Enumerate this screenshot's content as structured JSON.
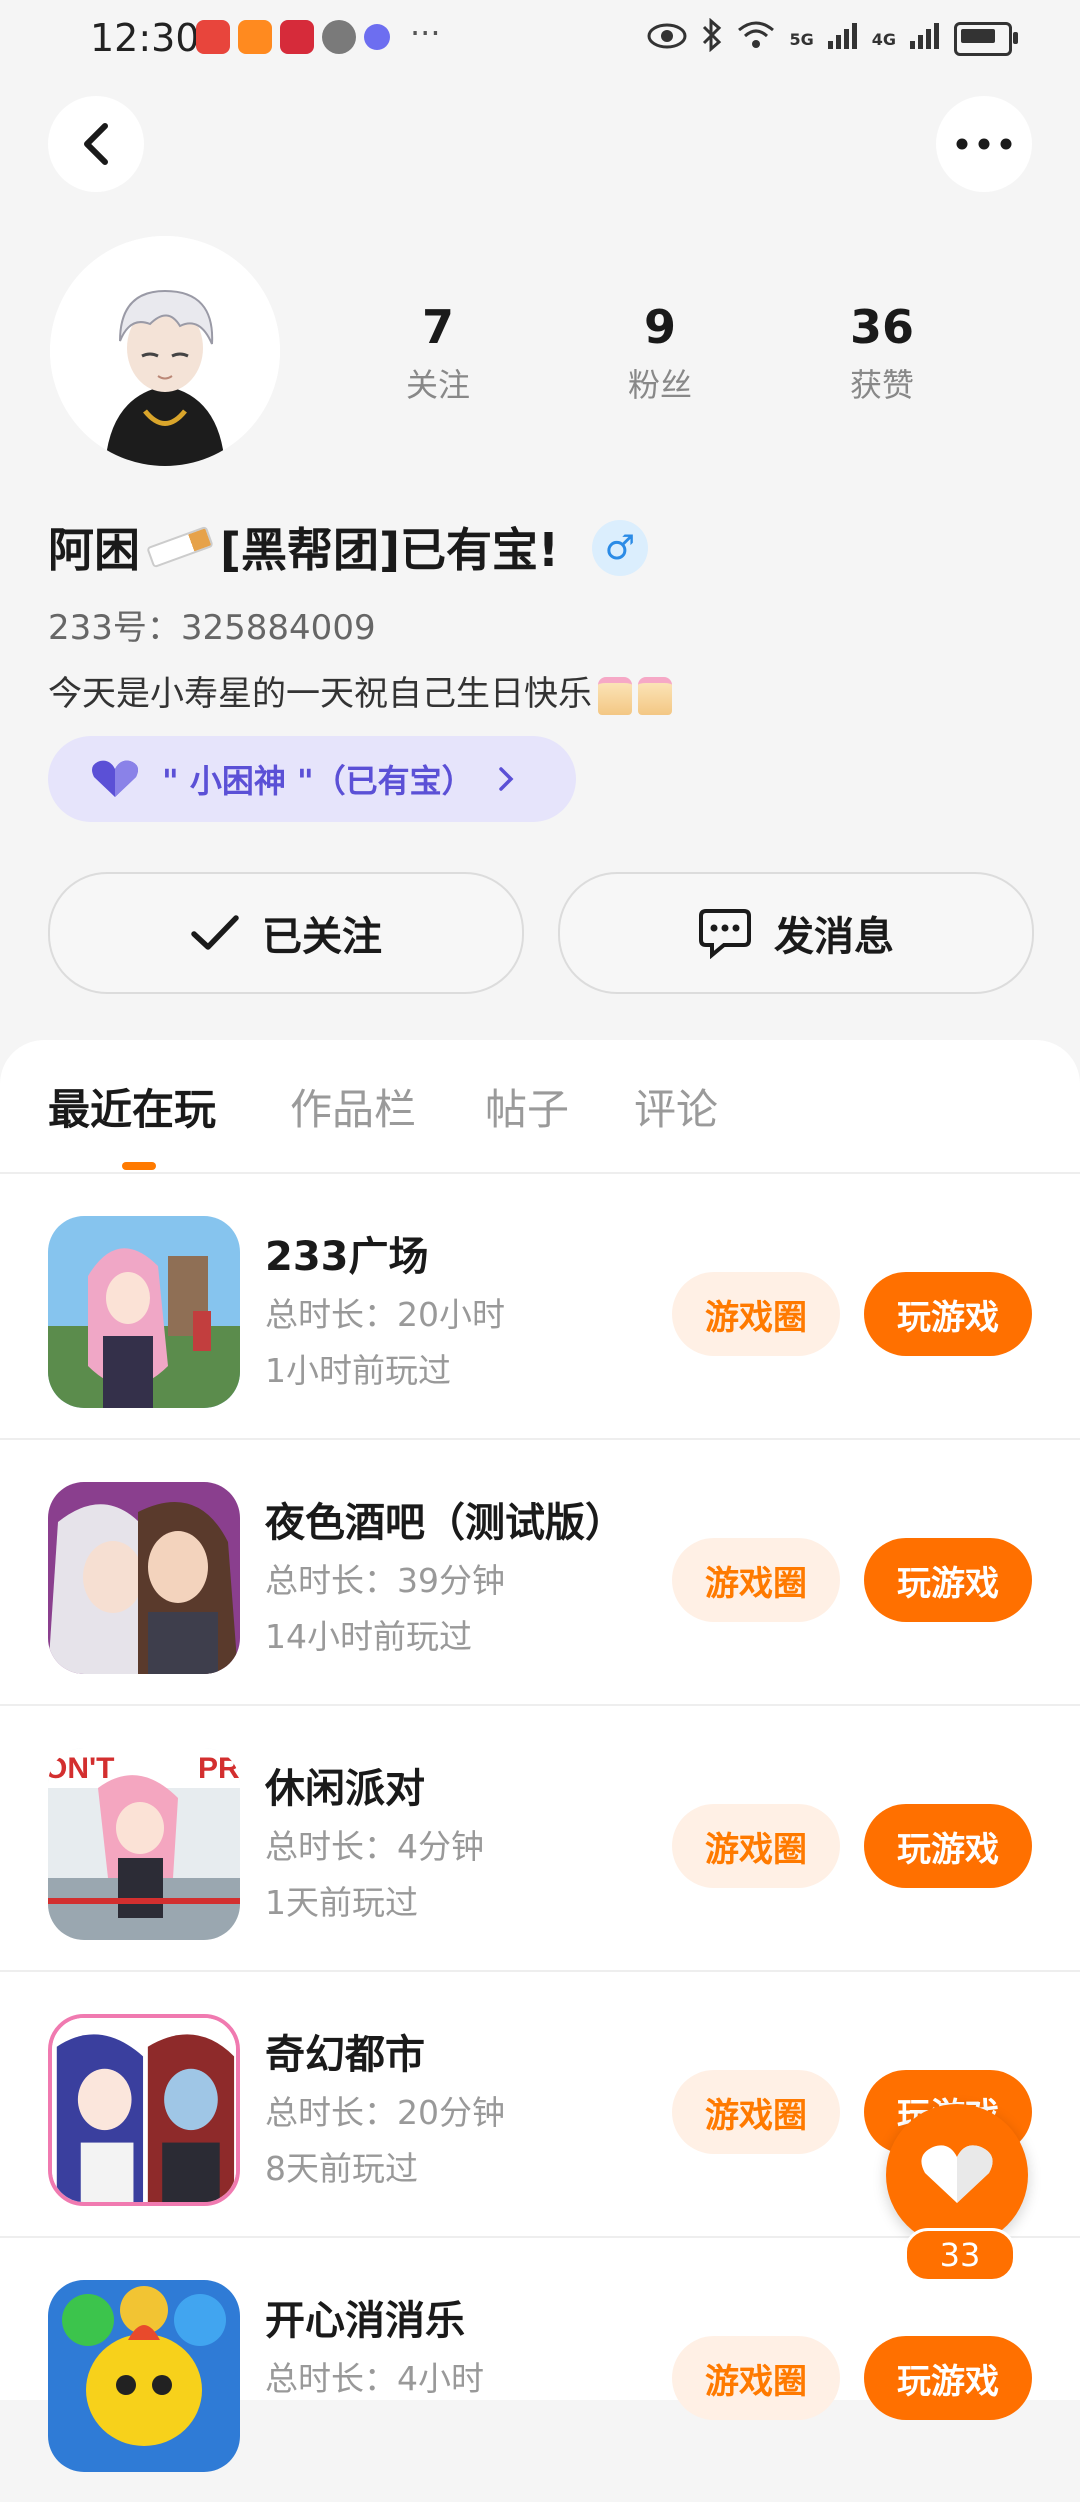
{
  "status_bar": {
    "time": "12:30",
    "more": "···",
    "signal_5g": "5G",
    "signal_4g": "4G"
  },
  "profile": {
    "stats": [
      {
        "value": "7",
        "label": "关注"
      },
      {
        "value": "9",
        "label": "粉丝"
      },
      {
        "value": "36",
        "label": "获赞"
      }
    ],
    "nickname_prefix": "阿困",
    "nickname_suffix": "[黑帮团]已有宝!",
    "gender_symbol": "♂",
    "uid": "233号：325884009",
    "bio": "今天是小寿星的一天祝自己生日快乐",
    "badge_text": "\" 小困神 \"（已有宝）",
    "follow_label": "已关注",
    "message_label": "发消息"
  },
  "tabs": [
    "最近在玩",
    "作品栏",
    "帖子",
    "评论"
  ],
  "games": [
    {
      "name": "233广场",
      "duration": "总时长：20小时",
      "last_played": "1小时前玩过",
      "circle_label": "游戏圈",
      "play_label": "玩游戏"
    },
    {
      "name": "夜色酒吧（测试版）",
      "duration": "总时长：39分钟",
      "last_played": "14小时前玩过",
      "circle_label": "游戏圈",
      "play_label": "玩游戏"
    },
    {
      "name": "休闲派对",
      "duration": "总时长：4分钟",
      "last_played": "1天前玩过",
      "circle_label": "游戏圈",
      "play_label": "玩游戏"
    },
    {
      "name": "奇幻都市",
      "duration": "总时长：20分钟",
      "last_played": "8天前玩过",
      "circle_label": "游戏圈",
      "play_label": "玩游戏"
    },
    {
      "name": "开心消消乐",
      "duration": "总时长：4小时",
      "last_played": "",
      "circle_label": "游戏圈",
      "play_label": "玩游戏"
    }
  ],
  "like_float": {
    "count": "33"
  },
  "colors": {
    "accent": "#ff7000",
    "accent_light": "#fff0e5",
    "badge_bg": "#e6e4fb",
    "badge_fg": "#5b50d6"
  }
}
